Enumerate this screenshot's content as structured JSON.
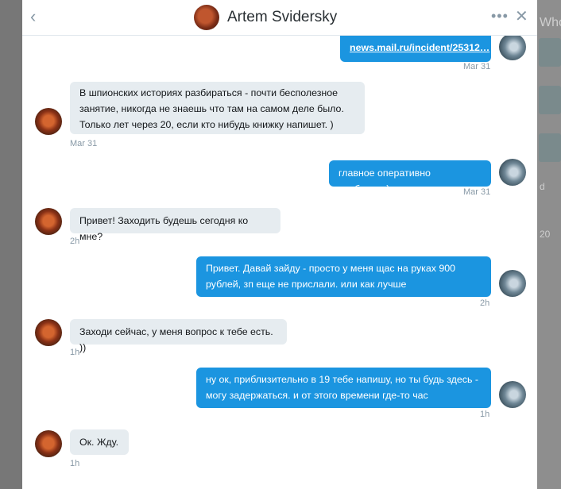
{
  "background": {
    "ghost_texts": [
      "Who",
      "20",
      "d"
    ]
  },
  "header": {
    "title": "Artem Svidersky",
    "back_glyph": "‹",
    "more_glyph": "•••",
    "close_glyph": "✕"
  },
  "messages": [
    {
      "from": "me",
      "text": "news.mail.ru/incident/25312…",
      "is_link": true,
      "time": "Mar 31"
    },
    {
      "from": "them",
      "text": "В шпионских историях разбираться - почти бесполезное занятие, никогда не знаешь что там на самом деле было. Только лет через 20, если кто нибудь книжку напишет. )",
      "time": "Mar 31"
    },
    {
      "from": "me",
      "text": "главное оперативно сработали)",
      "time": "Mar 31"
    },
    {
      "from": "them",
      "text": "Привет! Заходить будешь сегодня ко мне?",
      "time": "2h"
    },
    {
      "from": "me",
      "text": "Привет.  Давай зайду - просто у меня щас на руках 900 рублей, зп еще не прислали. или как лучше",
      "time": "2h"
    },
    {
      "from": "them",
      "text": "Заходи сейчас, у меня вопрос к тебе есть. ))",
      "time": "1h"
    },
    {
      "from": "me",
      "text": "ну ок, приблизительно в 19 тебе напишу, но ты будь здесь - могу задержаться. и от этого времени где-то час",
      "time": "1h"
    },
    {
      "from": "them",
      "text": "Ок. Жду.",
      "time": "1h"
    }
  ],
  "colors": {
    "outgoing_bubble": "#1b95e0",
    "incoming_bubble": "#e6ecf0",
    "timestamp": "#8899a6"
  }
}
